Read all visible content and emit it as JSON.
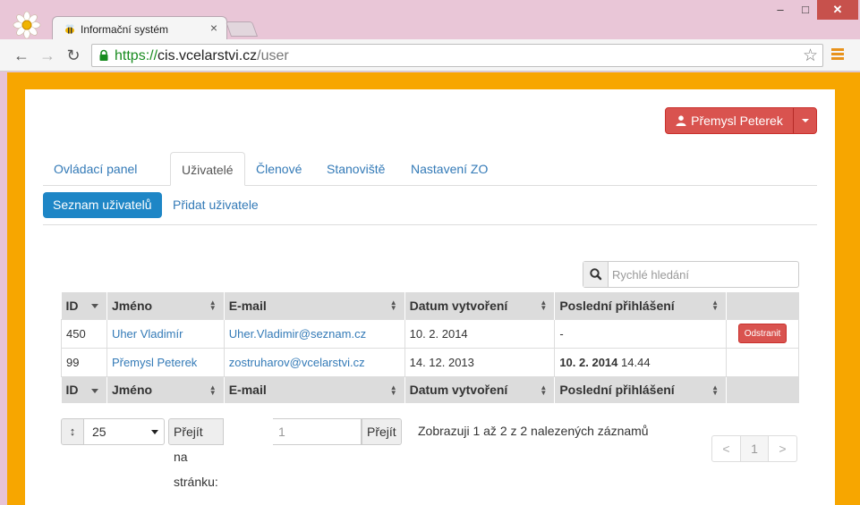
{
  "browser": {
    "tab_title": "Informační systém",
    "tab_close": "×",
    "url_scheme": "https://",
    "url_host": "cis.vcelarstvi.cz",
    "url_path": "/user",
    "window_min": "–",
    "window_max": "□",
    "window_close": "✕"
  },
  "header": {
    "user_name": "Přemysl Peterek"
  },
  "main_tabs": [
    {
      "label": "Ovládací panel",
      "active": false
    },
    {
      "label": "Uživatelé",
      "active": true
    },
    {
      "label": "Členové",
      "active": false
    },
    {
      "label": "Stanoviště",
      "active": false
    },
    {
      "label": "Nastavení ZO",
      "active": false
    }
  ],
  "sub_tabs": [
    {
      "label": "Seznam uživatelů",
      "active": true
    },
    {
      "label": "Přidat uživatele",
      "active": false
    }
  ],
  "search": {
    "placeholder": "Rychlé hledání"
  },
  "table": {
    "columns": [
      "ID",
      "Jméno",
      "E-mail",
      "Datum vytvoření",
      "Poslední přihlášení",
      ""
    ],
    "rows": [
      {
        "id": "450",
        "name": "Uher Vladimír",
        "email": "Uher.Vladimir@seznam.cz",
        "created": "10. 2. 2014",
        "last_login_date": "-",
        "last_login_time": "",
        "action": "Odstranit"
      },
      {
        "id": "99",
        "name": "Přemysl Peterek",
        "email": "zostruharov@vcelarstvi.cz",
        "created": "14. 12. 2013",
        "last_login_date": "10. 2. 2014",
        "last_login_time": "14.44",
        "action": ""
      }
    ]
  },
  "pager": {
    "size_icon": "↕",
    "page_size": "25",
    "goto_label": "Přejít na stránku:",
    "goto_value": "1",
    "goto_button": "Přejít",
    "info": "Zobrazuji 1 až 2 z 2 nalezených záznamů",
    "prev": "<",
    "current": "1",
    "next": ">"
  },
  "colors": {
    "accent": "#1e86c6",
    "danger": "#d9534f",
    "page_background": "#f7a600"
  }
}
